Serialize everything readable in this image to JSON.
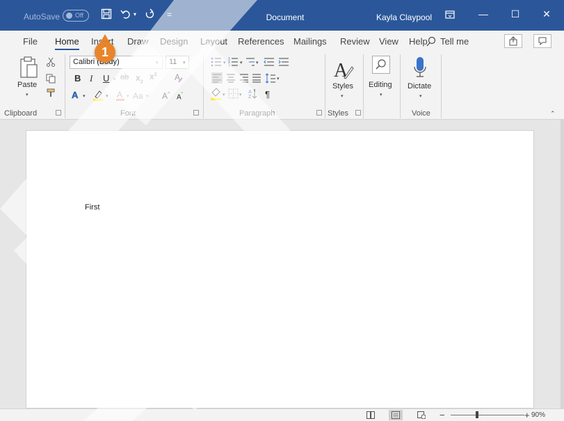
{
  "titlebar": {
    "autosave_label": "AutoSave",
    "autosave_state": "Off",
    "doc_title": "Document",
    "user_name": "Kayla Claypool"
  },
  "tabs": [
    {
      "label": "File"
    },
    {
      "label": "Home"
    },
    {
      "label": "Insert"
    },
    {
      "label": "Draw"
    },
    {
      "label": "Design"
    },
    {
      "label": "Layout"
    },
    {
      "label": "References"
    },
    {
      "label": "Mailings"
    },
    {
      "label": "Review"
    },
    {
      "label": "View"
    },
    {
      "label": "Help"
    }
  ],
  "tell_me": "Tell me",
  "ribbon": {
    "clipboard": {
      "paste_label": "Paste",
      "group_label": "Clipboard"
    },
    "font": {
      "font_name": "Calibri (Body)",
      "font_size": "11",
      "case_label": "Aa",
      "group_label": "Font"
    },
    "paragraph": {
      "group_label": "Paragraph"
    },
    "styles": {
      "styles_label": "Styles",
      "group_label": "Styles"
    },
    "editing": {
      "editing_label": "Editing"
    },
    "voice": {
      "dictate_label": "Dictate",
      "group_label": "Voice"
    }
  },
  "document": {
    "text": "First"
  },
  "statusbar": {
    "zoom_level": "90%"
  },
  "callout": {
    "number": "1"
  },
  "colors": {
    "accent": "#2b579a",
    "callout": "#e8852a",
    "highlight": "#ffeb3b",
    "font_color": "#e23b3b"
  }
}
